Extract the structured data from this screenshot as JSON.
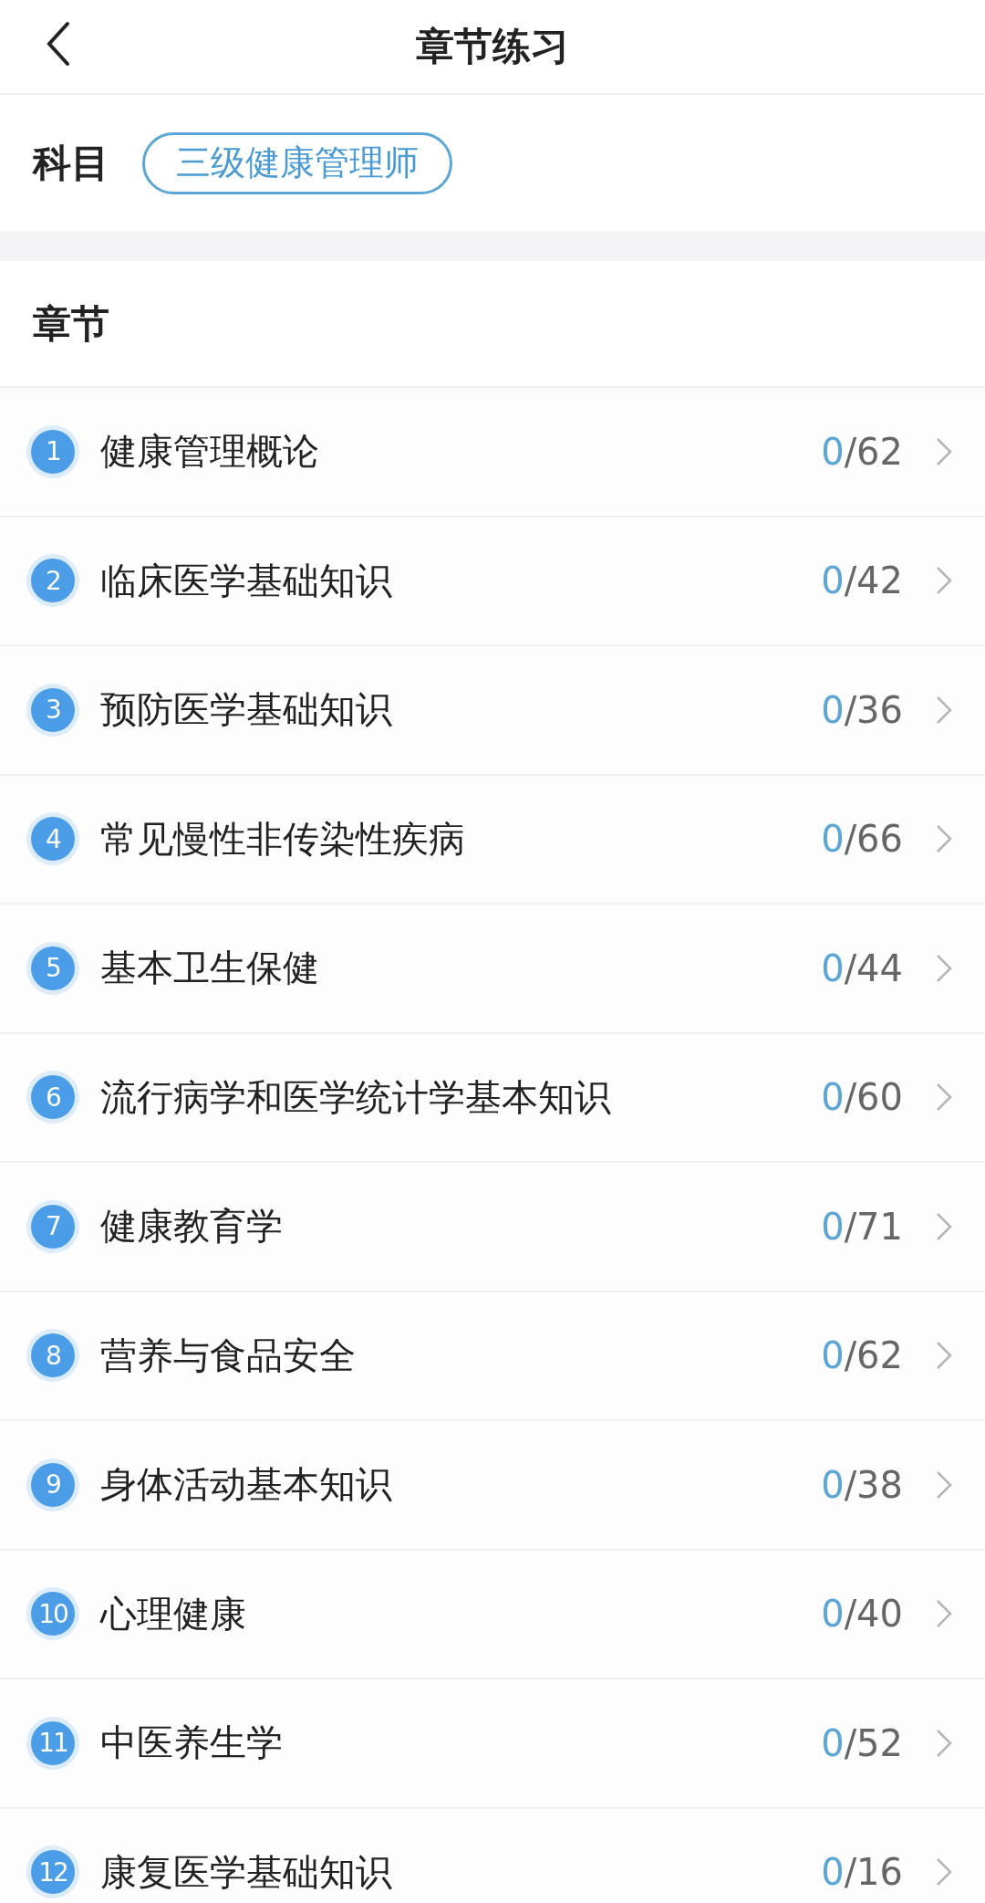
{
  "nav": {
    "title": "章节练习"
  },
  "subject": {
    "label": "科目",
    "value": "三级健康管理师"
  },
  "chapters": {
    "heading": "章节",
    "items": [
      {
        "number": "1",
        "name": "健康管理概论",
        "done": "0",
        "total": "/62"
      },
      {
        "number": "2",
        "name": "临床医学基础知识",
        "done": "0",
        "total": "/42"
      },
      {
        "number": "3",
        "name": "预防医学基础知识",
        "done": "0",
        "total": "/36"
      },
      {
        "number": "4",
        "name": "常见慢性非传染性疾病",
        "done": "0",
        "total": "/66"
      },
      {
        "number": "5",
        "name": "基本卫生保健",
        "done": "0",
        "total": "/44"
      },
      {
        "number": "6",
        "name": "流行病学和医学统计学基本知识",
        "done": "0",
        "total": "/60"
      },
      {
        "number": "7",
        "name": "健康教育学",
        "done": "0",
        "total": "/71"
      },
      {
        "number": "8",
        "name": "营养与食品安全",
        "done": "0",
        "total": "/62"
      },
      {
        "number": "9",
        "name": "身体活动基本知识",
        "done": "0",
        "total": "/38"
      },
      {
        "number": "10",
        "name": "心理健康",
        "done": "0",
        "total": "/40"
      },
      {
        "number": "11",
        "name": "中医养生学",
        "done": "0",
        "total": "/52"
      },
      {
        "number": "12",
        "name": "康复医学基础知识",
        "done": "0",
        "total": "/16"
      }
    ]
  }
}
